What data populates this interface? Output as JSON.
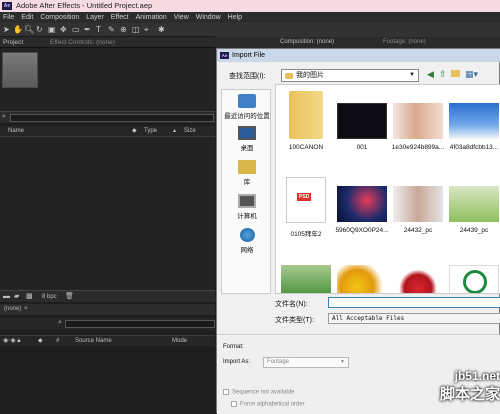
{
  "window": {
    "title": "Adobe After Effects - Untitled Project.aep",
    "app_badge": "Ae"
  },
  "menu": [
    "File",
    "Edit",
    "Composition",
    "Layer",
    "Effect",
    "Animation",
    "View",
    "Window",
    "Help"
  ],
  "panels": {
    "project_tab": "Project",
    "effect_controls_tab": "Effect Controls: (none)",
    "composition_tab": "Composition: (none)",
    "footage_tab": "Footage: (none)",
    "project_columns": {
      "name": "Name",
      "type": "Type",
      "size": "Size"
    },
    "bpc": "8 bpc",
    "timeline_tab": "(none)",
    "timeline_columns": {
      "hash": "#",
      "source_name": "Source Name",
      "mode": "Mode"
    }
  },
  "dialog": {
    "title": "Import File",
    "look_in_label": "查找范围(I):",
    "look_in_value": "我的图片",
    "places": [
      "最近访问的位置",
      "桌面",
      "库",
      "计算机",
      "网络"
    ],
    "files": [
      {
        "name": "100CANON",
        "kind": "folder"
      },
      {
        "name": "001",
        "kind": "dark"
      },
      {
        "name": "1e30e924b899a...",
        "kind": "portrait"
      },
      {
        "name": "4f03a8dfcbb13...",
        "kind": "sky"
      },
      {
        "name": "0105拜年2",
        "kind": "psd",
        "badge": "PSD"
      },
      {
        "name": "5960Q9XO0P24...",
        "kind": "space"
      },
      {
        "name": "24432_pc",
        "kind": "girl"
      },
      {
        "name": "24439_pc",
        "kind": "field"
      },
      {
        "name": "",
        "kind": "grass"
      },
      {
        "name": "",
        "kind": "lemon"
      },
      {
        "name": "",
        "kind": "apple"
      },
      {
        "name": "",
        "kind": "logo"
      }
    ],
    "filename_label": "文件名(N):",
    "filename_value": "",
    "filetype_label": "文件类型(T):",
    "filetype_value": "All Acceptable Files",
    "format_label": "Format:",
    "import_as_label": "Import As:",
    "import_as_value": "Footage",
    "sequence_label": "Sequence not available",
    "alpha_order_label": "Force alphabetical order"
  },
  "watermark": {
    "site": "jb51.net",
    "name": "脚本之家"
  }
}
